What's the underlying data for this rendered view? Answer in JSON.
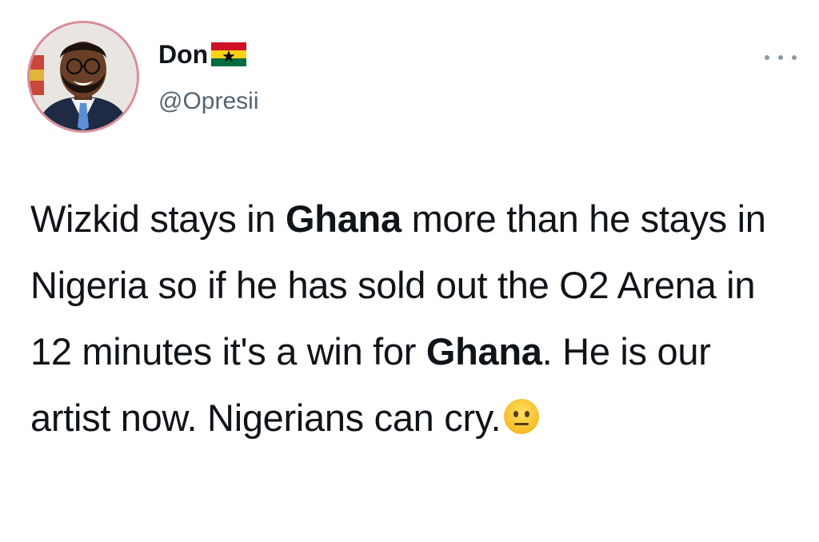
{
  "user": {
    "display_name": "Don",
    "handle": "@Opresii",
    "avatar_icon": "avatar-photo",
    "flag_icon": "ghana-flag-icon"
  },
  "menu": {
    "icon": "more-icon"
  },
  "tweet": {
    "segments": {
      "s1": "Wizkid stays in ",
      "s2": "Ghana",
      "s3": " more than he stays in Nigeria so if he has sold out the O2 Arena in 12 minutes it's a win for ",
      "s4": "Ghana",
      "s5": ". He is our artist now. Nigerians can cry.",
      "emoji": "neutral-face-emoji"
    }
  },
  "colors": {
    "text": "#0f1419",
    "secondary": "#536471",
    "avatar_border": "#d98d9a",
    "flag_red": "#ce1126",
    "flag_gold": "#fcd116",
    "flag_green": "#006b3f"
  }
}
